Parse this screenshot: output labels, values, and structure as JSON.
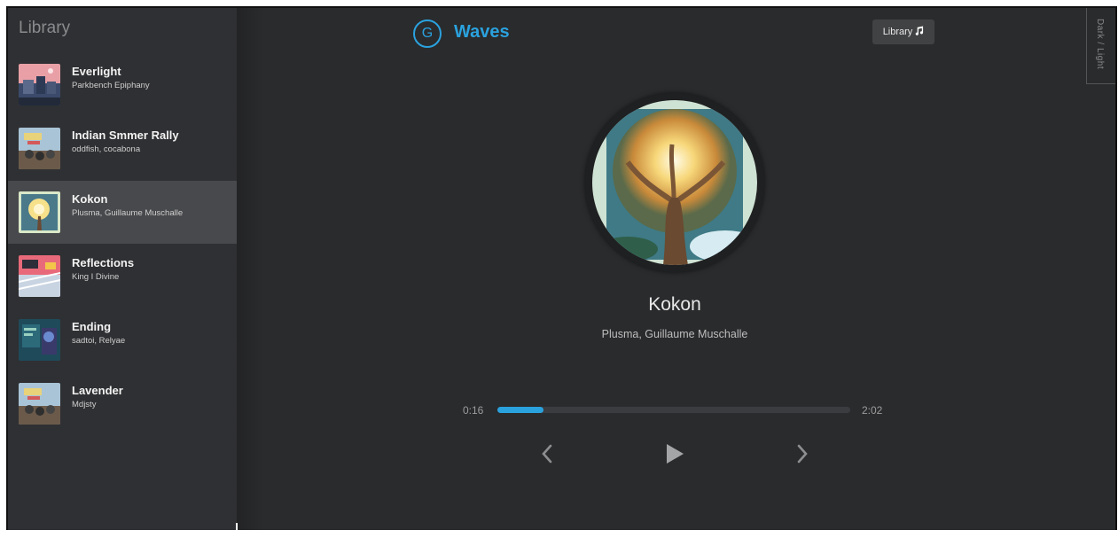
{
  "sidebar": {
    "title": "Library",
    "items": [
      {
        "name": "Everlight",
        "artist": "Parkbench Epiphany",
        "active": false
      },
      {
        "name": "Indian Smmer Rally",
        "artist": "oddfish, cocabona",
        "active": false
      },
      {
        "name": "Kokon",
        "artist": "Plusma, Guillaume Muschalle",
        "active": true
      },
      {
        "name": "Reflections",
        "artist": "King I Divine",
        "active": false
      },
      {
        "name": "Ending",
        "artist": "sadtoi, Relyae",
        "active": false
      },
      {
        "name": "Lavender",
        "artist": "Mdjsty",
        "active": false
      }
    ]
  },
  "header": {
    "logo_letter": "G",
    "app_name": "Waves",
    "library_button": "Library",
    "library_icon": "music-note-icon",
    "theme_toggle": "Dark / Light"
  },
  "player": {
    "title": "Kokon",
    "artist": "Plusma, Guillaume Muschalle",
    "current_time": "0:16",
    "duration": "2:02",
    "progress": 0.131,
    "controls": {
      "prev_icon": "chevron-left-icon",
      "play_icon": "play-icon",
      "next_icon": "chevron-right-icon"
    }
  },
  "colors": {
    "accent": "#2aa2de",
    "background": "#2a2b2d",
    "sidebar": "#2f3033",
    "active_item": "#48494c"
  }
}
